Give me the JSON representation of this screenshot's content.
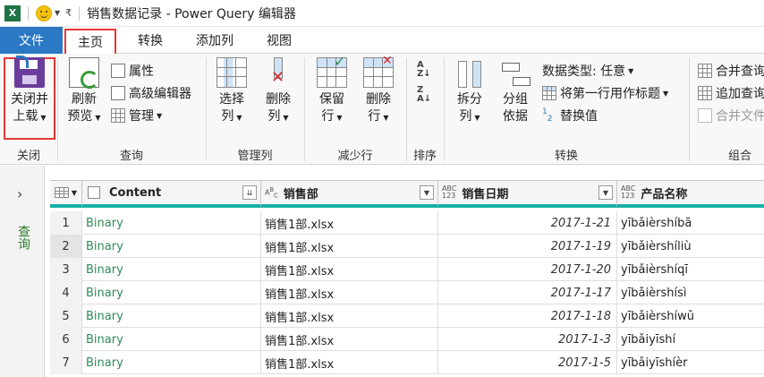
{
  "window": {
    "title": "销售数据记录 - Power Query 编辑器",
    "app_icon": "X"
  },
  "tabs": {
    "file": "文件",
    "home": "主页",
    "transform": "转换",
    "add_column": "添加列",
    "view": "视图"
  },
  "ribbon": {
    "close": {
      "close_load_line1": "关闭并",
      "close_load_line2": "上载",
      "group": "关闭"
    },
    "query": {
      "refresh_line1": "刷新",
      "refresh_line2": "预览",
      "properties": "属性",
      "advanced_editor": "高级编辑器",
      "manage": "管理",
      "group": "查询"
    },
    "manage_columns": {
      "choose_line1": "选择",
      "choose_line2": "列",
      "remove_line1": "删除",
      "remove_line2": "列",
      "group": "管理列"
    },
    "reduce_rows": {
      "keep_line1": "保留",
      "keep_line2": "行",
      "remove_line1": "删除",
      "remove_line2": "行",
      "group": "减少行"
    },
    "sort": {
      "group": "排序"
    },
    "transform": {
      "split_line1": "拆分",
      "split_line2": "列",
      "group_line1": "分组",
      "group_line2": "依据",
      "data_type": "数据类型: 任意",
      "first_row_header": "将第一行用作标题",
      "replace_values": "替换值",
      "group": "转换"
    },
    "combine": {
      "merge_queries": "合并查询",
      "append_queries": "追加查询",
      "combine_files": "合并文件",
      "group": "组合"
    }
  },
  "queries_pane": {
    "label": "查询"
  },
  "grid": {
    "columns": [
      {
        "name": "Content",
        "type": ""
      },
      {
        "name": "销售部",
        "type": "ABC"
      },
      {
        "name": "销售日期",
        "type": "ABC123"
      },
      {
        "name": "产品名称",
        "type": "ABC123"
      }
    ],
    "rows": [
      {
        "idx": "1",
        "content": "Binary",
        "dept": "销售1部.xlsx",
        "date": "2017-1-21",
        "product": "yībǎièrshíbā"
      },
      {
        "idx": "2",
        "content": "Binary",
        "dept": "销售1部.xlsx",
        "date": "2017-1-19",
        "product": "yībǎièrshíliù"
      },
      {
        "idx": "3",
        "content": "Binary",
        "dept": "销售1部.xlsx",
        "date": "2017-1-20",
        "product": "yībǎièrshíqī"
      },
      {
        "idx": "4",
        "content": "Binary",
        "dept": "销售1部.xlsx",
        "date": "2017-1-17",
        "product": "yībǎièrshísì"
      },
      {
        "idx": "5",
        "content": "Binary",
        "dept": "销售1部.xlsx",
        "date": "2017-1-18",
        "product": "yībǎièrshíwǔ"
      },
      {
        "idx": "6",
        "content": "Binary",
        "dept": "销售1部.xlsx",
        "date": "2017-1-3",
        "product": "yībǎiyīshí"
      },
      {
        "idx": "7",
        "content": "Binary",
        "dept": "销售1部.xlsx",
        "date": "2017-1-5",
        "product": "yībǎiyīshíèr"
      }
    ]
  },
  "colors": {
    "accent": "#2b78c5",
    "highlight": "#e53935",
    "header_rule": "#17b0a6",
    "binary": "#2e8b57"
  }
}
